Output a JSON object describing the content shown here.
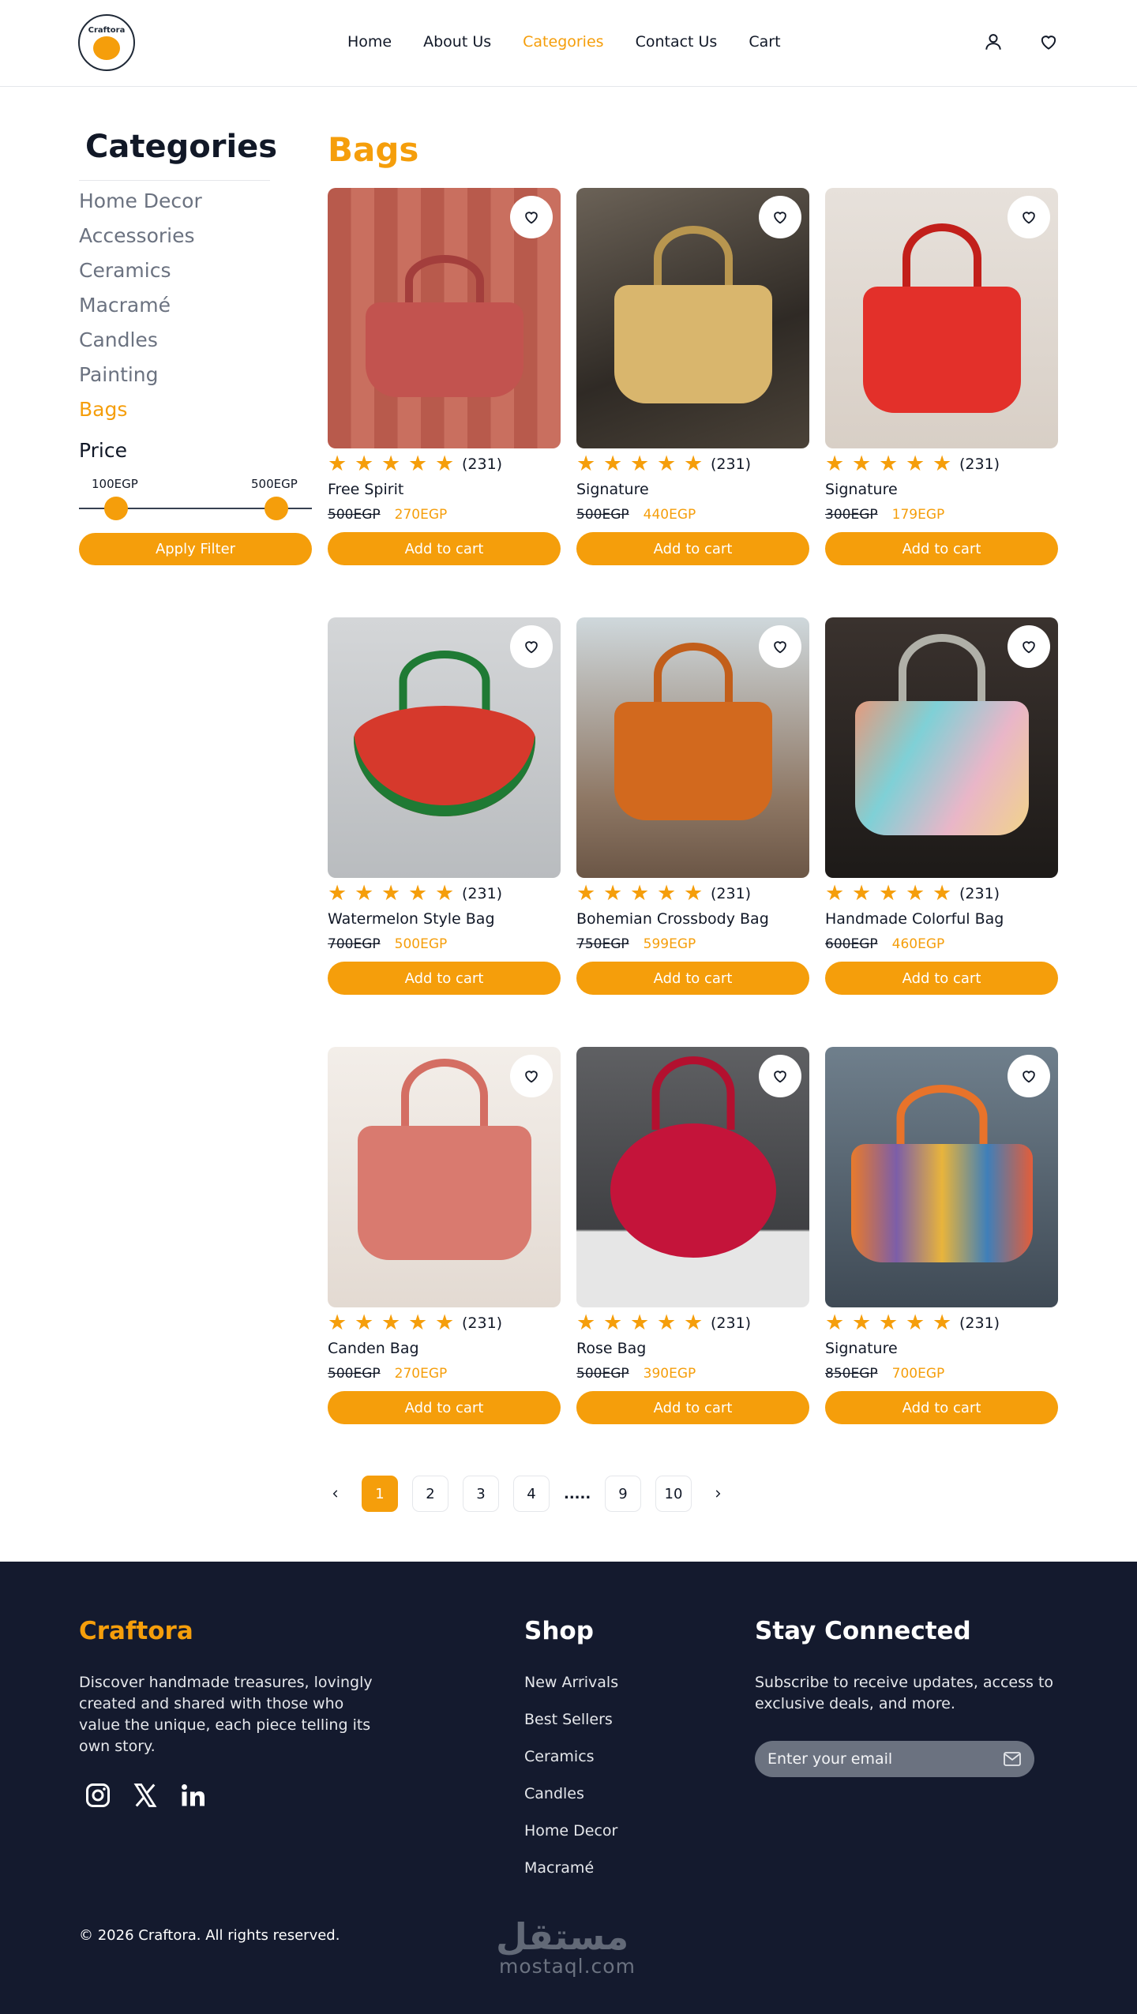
{
  "header": {
    "brand": "Craftora",
    "nav": [
      "Home",
      "About Us",
      "Categories",
      "Contact Us",
      "Cart"
    ],
    "active_nav": "Categories"
  },
  "sidebar": {
    "title": "Categories",
    "items": [
      "Home Decor",
      "Accessories",
      "Ceramics",
      "Macramé",
      "Candles",
      "Painting",
      "Bags"
    ],
    "active_item": "Bags",
    "price_title": "Price",
    "price_min": "100EGP",
    "price_max": "500EGP",
    "apply_label": "Apply Filter"
  },
  "main": {
    "title": "Bags",
    "add_label": "Add to cart",
    "rating_stars": 5,
    "products": [
      {
        "name": "Free Spirit",
        "rating_count": "(231)",
        "old_price": "500EGP",
        "new_price": "270EGP",
        "image": "red-leather-shoulder-bag"
      },
      {
        "name": "Signature",
        "rating_count": "(231)",
        "old_price": "500EGP",
        "new_price": "440EGP",
        "image": "beige-leather-handbag"
      },
      {
        "name": "Signature",
        "rating_count": "(231)",
        "old_price": "300EGP",
        "new_price": "179EGP",
        "image": "red-patent-handbag"
      },
      {
        "name": "Watermelon Style Bag",
        "rating_count": "(231)",
        "old_price": "700EGP",
        "new_price": "500EGP",
        "image": "crochet-watermelon-bag"
      },
      {
        "name": "Bohemian Crossbody Bag",
        "rating_count": "(231)",
        "old_price": "750EGP",
        "new_price": "599EGP",
        "image": "orange-crochet-crossbody"
      },
      {
        "name": "Handmade Colorful Bag",
        "rating_count": "(231)",
        "old_price": "600EGP",
        "new_price": "460EGP",
        "image": "multicolor-crochet-bag"
      },
      {
        "name": "Canden Bag",
        "rating_count": "(231)",
        "old_price": "500EGP",
        "new_price": "270EGP",
        "image": "pink-crochet-backpack"
      },
      {
        "name": "Rose Bag",
        "rating_count": "(231)",
        "old_price": "500EGP",
        "new_price": "390EGP",
        "image": "red-rose-crochet-bag"
      },
      {
        "name": "Signature",
        "rating_count": "(231)",
        "old_price": "850EGP",
        "new_price": "700EGP",
        "image": "colorful-braided-bag"
      }
    ]
  },
  "pagination": {
    "pages": [
      "1",
      "2",
      "3",
      "4",
      ".....",
      "9",
      "10"
    ],
    "active": "1"
  },
  "footer": {
    "brand": "Craftora",
    "description": "Discover handmade treasures, lovingly created and shared with those who value the unique, each piece telling its own story.",
    "social": [
      "instagram-icon",
      "x-icon",
      "linkedin-icon"
    ],
    "shop_title": "Shop",
    "shop_links": [
      "New Arrivals",
      "Best Sellers",
      "Ceramics",
      "Candles",
      "Home Decor",
      "Macramé"
    ],
    "stay_title": "Stay Connected",
    "stay_text": "Subscribe to receive updates, access to exclusive deals, and more.",
    "email_placeholder": "Enter your email",
    "copyright": "© 2026 Craftora. All rights reserved.",
    "watermark_ar": "مستقل",
    "watermark_en": "mostaql.com"
  },
  "colors": {
    "accent": "#f59e0b",
    "footer_bg": "#141a2e",
    "text": "#111827",
    "muted": "#6b7280"
  }
}
